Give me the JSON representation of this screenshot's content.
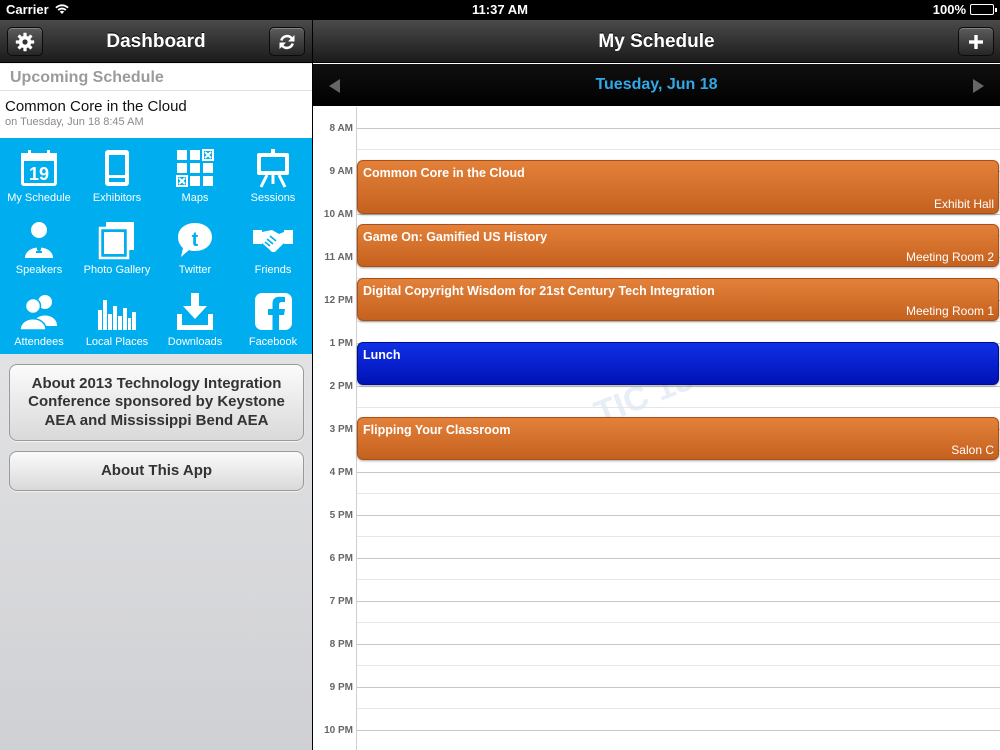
{
  "status": {
    "carrier": "Carrier",
    "time": "11:37 AM",
    "battery": "100%"
  },
  "left": {
    "title": "Dashboard",
    "upcoming": {
      "header": "Upcoming Schedule",
      "item_title": "Common Core in the Cloud",
      "item_sub": "on Tuesday, Jun 18 8:45 AM"
    },
    "tiles": [
      {
        "label": "My Schedule",
        "icon": "calendar-icon",
        "date": "19"
      },
      {
        "label": "Exhibitors",
        "icon": "exhibitor-booth-icon"
      },
      {
        "label": "Maps",
        "icon": "map-grid-icon"
      },
      {
        "label": "Sessions",
        "icon": "easel-icon"
      },
      {
        "label": "Speakers",
        "icon": "speaker-icon"
      },
      {
        "label": "Photo Gallery",
        "icon": "photo-gallery-icon"
      },
      {
        "label": "Twitter",
        "icon": "twitter-icon"
      },
      {
        "label": "Friends",
        "icon": "handshake-icon"
      },
      {
        "label": "Attendees",
        "icon": "attendees-icon"
      },
      {
        "label": "Local Places",
        "icon": "city-skyline-icon"
      },
      {
        "label": "Downloads",
        "icon": "download-icon"
      },
      {
        "label": "Facebook",
        "icon": "facebook-icon"
      }
    ],
    "about_conference": "About 2013 Technology Integration Conference sponsored by Keystone AEA and Mississippi Bend AEA",
    "about_app": "About This App"
  },
  "right": {
    "title": "My Schedule",
    "date": "Tuesday, Jun 18",
    "hours": [
      "8 AM",
      "9 AM",
      "10 AM",
      "11 AM",
      "12 PM",
      "1 PM",
      "2 PM",
      "3 PM",
      "4 PM",
      "5 PM",
      "6 PM",
      "7 PM",
      "8 PM",
      "9 PM",
      "10 PM"
    ],
    "watermark": "TIC 13",
    "events": [
      {
        "title": "Common Core in the Cloud",
        "location": "Exhibit Hall",
        "color": "#d4722c"
      },
      {
        "title": "Game On: Gamified US History",
        "location": "Meeting Room 2",
        "color": "#d4722c"
      },
      {
        "title": "Digital Copyright Wisdom for 21st Century Tech Integration",
        "location": "Meeting Room 1",
        "color": "#d4722c"
      },
      {
        "title": "Lunch",
        "location": "",
        "color": "#0a22d4"
      },
      {
        "title": "Flipping Your Classroom",
        "location": "Salon C",
        "color": "#d4722c"
      }
    ]
  },
  "colors": {
    "tile_bg": "#00aeef",
    "date_text": "#32a8e6",
    "event_orange": "#d4722c",
    "event_blue": "#0a22d4"
  }
}
